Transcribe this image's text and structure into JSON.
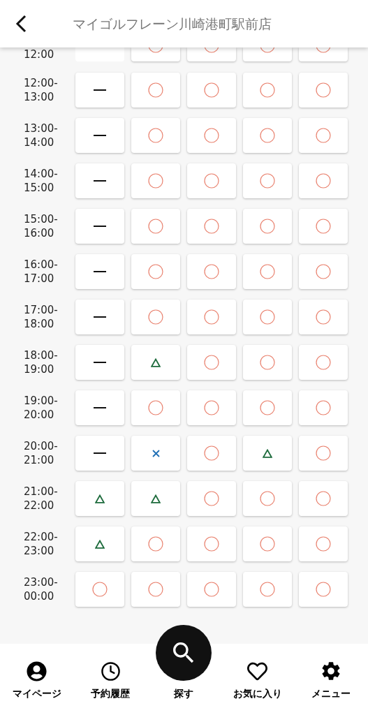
{
  "header": {
    "title": "マイゴルフレーン川崎港町駅前店"
  },
  "rows": [
    {
      "label": "12:00",
      "kind": "cut",
      "cells": [
        {
          "kind": "blank"
        },
        {
          "kind": "open"
        },
        {
          "kind": "open"
        },
        {
          "kind": "open"
        },
        {
          "kind": "open"
        }
      ]
    },
    {
      "label": "12:00-13:00",
      "cells": [
        {
          "kind": "closed"
        },
        {
          "kind": "open"
        },
        {
          "kind": "open"
        },
        {
          "kind": "open"
        },
        {
          "kind": "open"
        }
      ]
    },
    {
      "label": "13:00-14:00",
      "cells": [
        {
          "kind": "closed"
        },
        {
          "kind": "open"
        },
        {
          "kind": "open"
        },
        {
          "kind": "open"
        },
        {
          "kind": "open"
        }
      ]
    },
    {
      "label": "14:00-15:00",
      "cells": [
        {
          "kind": "closed"
        },
        {
          "kind": "open"
        },
        {
          "kind": "open"
        },
        {
          "kind": "open"
        },
        {
          "kind": "open"
        }
      ]
    },
    {
      "label": "15:00-16:00",
      "cells": [
        {
          "kind": "closed"
        },
        {
          "kind": "open"
        },
        {
          "kind": "open"
        },
        {
          "kind": "open"
        },
        {
          "kind": "open"
        }
      ]
    },
    {
      "label": "16:00-17:00",
      "cells": [
        {
          "kind": "closed"
        },
        {
          "kind": "open"
        },
        {
          "kind": "open"
        },
        {
          "kind": "open"
        },
        {
          "kind": "open"
        }
      ]
    },
    {
      "label": "17:00-18:00",
      "cells": [
        {
          "kind": "closed"
        },
        {
          "kind": "open"
        },
        {
          "kind": "open"
        },
        {
          "kind": "open"
        },
        {
          "kind": "open"
        }
      ]
    },
    {
      "label": "18:00-19:00",
      "cells": [
        {
          "kind": "closed"
        },
        {
          "kind": "few"
        },
        {
          "kind": "open"
        },
        {
          "kind": "open"
        },
        {
          "kind": "open"
        }
      ]
    },
    {
      "label": "19:00-20:00",
      "cells": [
        {
          "kind": "closed"
        },
        {
          "kind": "open"
        },
        {
          "kind": "open"
        },
        {
          "kind": "open"
        },
        {
          "kind": "open"
        }
      ]
    },
    {
      "label": "20:00-21:00",
      "cells": [
        {
          "kind": "closed"
        },
        {
          "kind": "full"
        },
        {
          "kind": "open"
        },
        {
          "kind": "few"
        },
        {
          "kind": "open"
        }
      ]
    },
    {
      "label": "21:00-22:00",
      "cells": [
        {
          "kind": "few"
        },
        {
          "kind": "few"
        },
        {
          "kind": "open"
        },
        {
          "kind": "open"
        },
        {
          "kind": "open"
        }
      ]
    },
    {
      "label": "22:00-23:00",
      "cells": [
        {
          "kind": "few"
        },
        {
          "kind": "open"
        },
        {
          "kind": "open"
        },
        {
          "kind": "open"
        },
        {
          "kind": "open"
        }
      ]
    },
    {
      "label": "23:00-00:00",
      "cells": [
        {
          "kind": "open"
        },
        {
          "kind": "open"
        },
        {
          "kind": "open"
        },
        {
          "kind": "open"
        },
        {
          "kind": "open"
        }
      ]
    }
  ],
  "nav": [
    {
      "kind": "person",
      "label": "マイページ",
      "selected": false
    },
    {
      "kind": "clock",
      "label": "予約履歴",
      "selected": false
    },
    {
      "kind": "search",
      "label": "探す",
      "selected": true
    },
    {
      "kind": "heart",
      "label": "お気に入り",
      "selected": false
    },
    {
      "kind": "gear",
      "label": "メニュー",
      "selected": false
    }
  ]
}
